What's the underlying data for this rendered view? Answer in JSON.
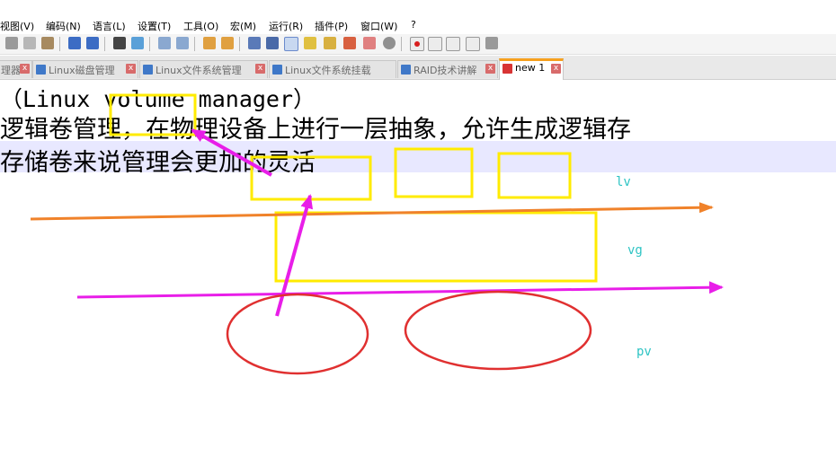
{
  "menubar": {
    "items": [
      "视图(V)",
      "编码(N)",
      "语言(L)",
      "设置(T)",
      "工具(O)",
      "宏(M)",
      "运行(R)",
      "插件(P)",
      "窗口(W)",
      "?"
    ]
  },
  "tabs": [
    {
      "label": "理器",
      "active": false
    },
    {
      "label": "Linux磁盘管理",
      "active": false
    },
    {
      "label": "Linux文件系统管理",
      "active": false
    },
    {
      "label": "Linux文件系统挂载",
      "active": false
    },
    {
      "label": "RAID技术讲解",
      "active": false
    },
    {
      "label": "new 1",
      "active": true
    }
  ],
  "editor": {
    "lines": [
      "（Linux volume manager）",
      "逻辑卷管理，在物理设备上进行一层抽象，允许生成逻辑存",
      "存储卷来说管理会更加的灵活"
    ]
  },
  "annotations": {
    "lv": "lv",
    "vg": "vg",
    "pv": "pv"
  },
  "colors": {
    "yellow_box": "#ffeb00",
    "magenta_arrow": "#e81ee8",
    "orange_arrow": "#f0822a",
    "red_ellipse": "#e03030",
    "annotation_text": "#2ec4c4",
    "active_tab_accent": "#f6a01e",
    "current_line": "#e8e8ff"
  }
}
